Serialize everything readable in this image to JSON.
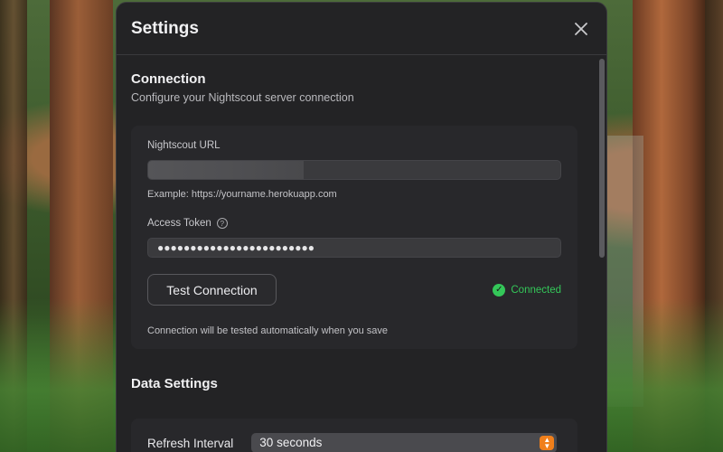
{
  "dialog": {
    "title": "Settings",
    "close_icon": "close-icon"
  },
  "connection": {
    "title": "Connection",
    "description": "Configure your Nightscout server connection",
    "url_label": "Nightscout URL",
    "url_value": "",
    "url_hint": "Example: https://yourname.herokuapp.com",
    "token_label": "Access Token",
    "token_help_icon": "question-circle-icon",
    "token_value": "●●●●●●●●●●●●●●●●●●●●●●●●",
    "test_button_label": "Test Connection",
    "status_text": "Connected",
    "status_icon": "checkmark-circle-icon",
    "auto_test_note": "Connection will be tested automatically when you save"
  },
  "data_settings": {
    "title": "Data Settings",
    "refresh_label": "Refresh Interval",
    "refresh_value": "30 seconds"
  },
  "colors": {
    "success": "#34c759",
    "accent": "#f07f1b",
    "dialog_bg": "#232325"
  }
}
